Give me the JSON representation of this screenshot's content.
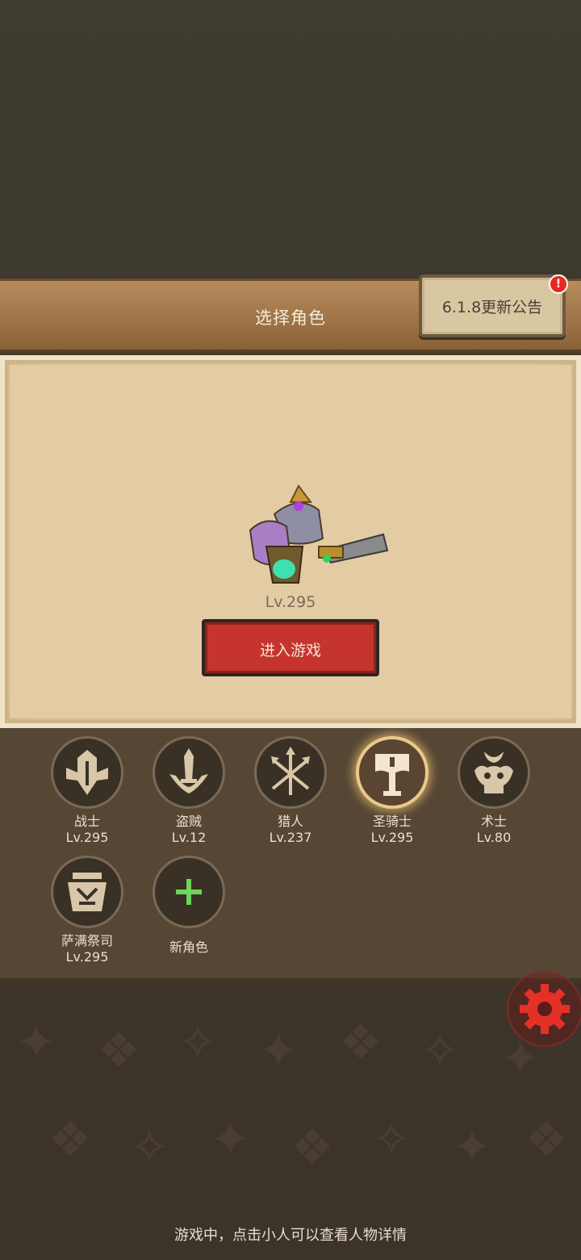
{
  "header": {
    "title": "选择角色"
  },
  "notice": {
    "label": "6.1.8更新公告",
    "alert": "!"
  },
  "selected": {
    "level": "Lv.295",
    "enter_label": "进入游戏"
  },
  "classes": [
    {
      "name": "战士",
      "level": "Lv.295",
      "icon": "warrior-icon"
    },
    {
      "name": "盗贼",
      "level": "Lv.12",
      "icon": "rogue-icon"
    },
    {
      "name": "猎人",
      "level": "Lv.237",
      "icon": "hunter-icon"
    },
    {
      "name": "圣骑士",
      "level": "Lv.295",
      "icon": "paladin-icon"
    },
    {
      "name": "术士",
      "level": "Lv.80",
      "icon": "warlock-icon"
    },
    {
      "name": "萨满祭司",
      "level": "Lv.295",
      "icon": "shaman-icon"
    },
    {
      "name": "新角色",
      "level": "",
      "icon": "plus-icon"
    }
  ],
  "hint": "游戏中，点击小人可以查看人物详情",
  "colors": {
    "accent_red": "#c5342e",
    "gear_red": "#e53027",
    "plus_green": "#6fd65a"
  }
}
